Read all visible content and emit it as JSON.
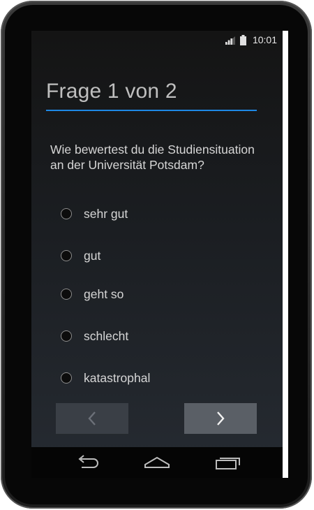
{
  "status_bar": {
    "time": "10:01",
    "signal_icon": "signal-icon",
    "battery_icon": "battery-icon"
  },
  "survey": {
    "title": "Frage 1 von 2",
    "question": "Wie bewertest du die Studiensituation an der Universität Potsdam?",
    "options": [
      "sehr gut",
      "gut",
      "geht so",
      "schlecht",
      "katastrophal"
    ],
    "selected": null
  },
  "navigation": {
    "prev_icon": "chevron-left-icon",
    "next_icon": "chevron-right-icon",
    "prev_enabled": false,
    "next_enabled": true
  },
  "system_nav": {
    "back_icon": "back-icon",
    "home_icon": "home-icon",
    "recents_icon": "recents-icon"
  },
  "colors": {
    "accent": "#1e88e5",
    "text": "#d6d6d6",
    "title": "#bfbfbf"
  }
}
